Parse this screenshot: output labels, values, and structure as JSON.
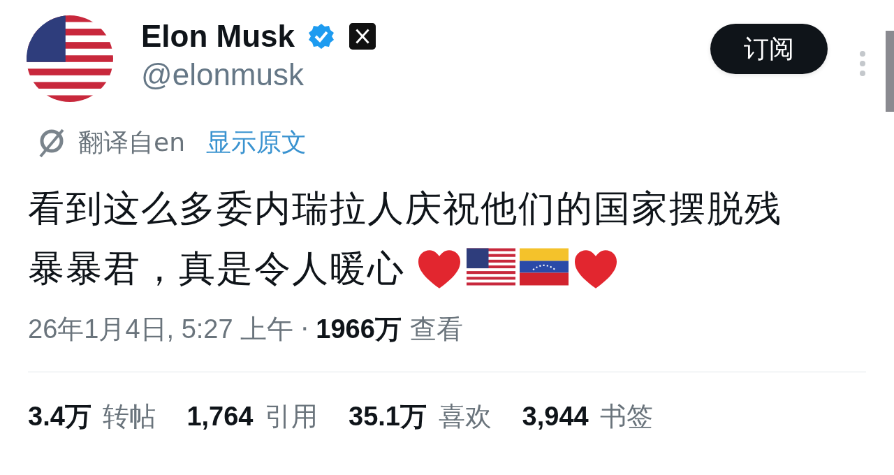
{
  "author": {
    "name": "Elon Musk",
    "verified": true,
    "handle": "@elonmusk"
  },
  "subscribe_button": "订阅",
  "translation": {
    "label": "翻译自en",
    "link": "显示原文"
  },
  "text_lines": [
    "看到这么多委内瑞拉人庆祝他们的国家摆脱残",
    "暴暴君，真是令人暖心"
  ],
  "emojis": [
    {
      "kind": "heart"
    },
    {
      "kind": "flag_us"
    },
    {
      "kind": "flag_ve"
    },
    {
      "kind": "heart"
    }
  ],
  "meta": {
    "date": "26年1月4日, 5:27 上午",
    "separator": "·",
    "views": "1966万",
    "views_label": "查看"
  },
  "stats": [
    "**3.4万** 转帖",
    "**1,764** 引用",
    "**35.1万** 喜欢",
    "**3,944** 书签"
  ]
}
